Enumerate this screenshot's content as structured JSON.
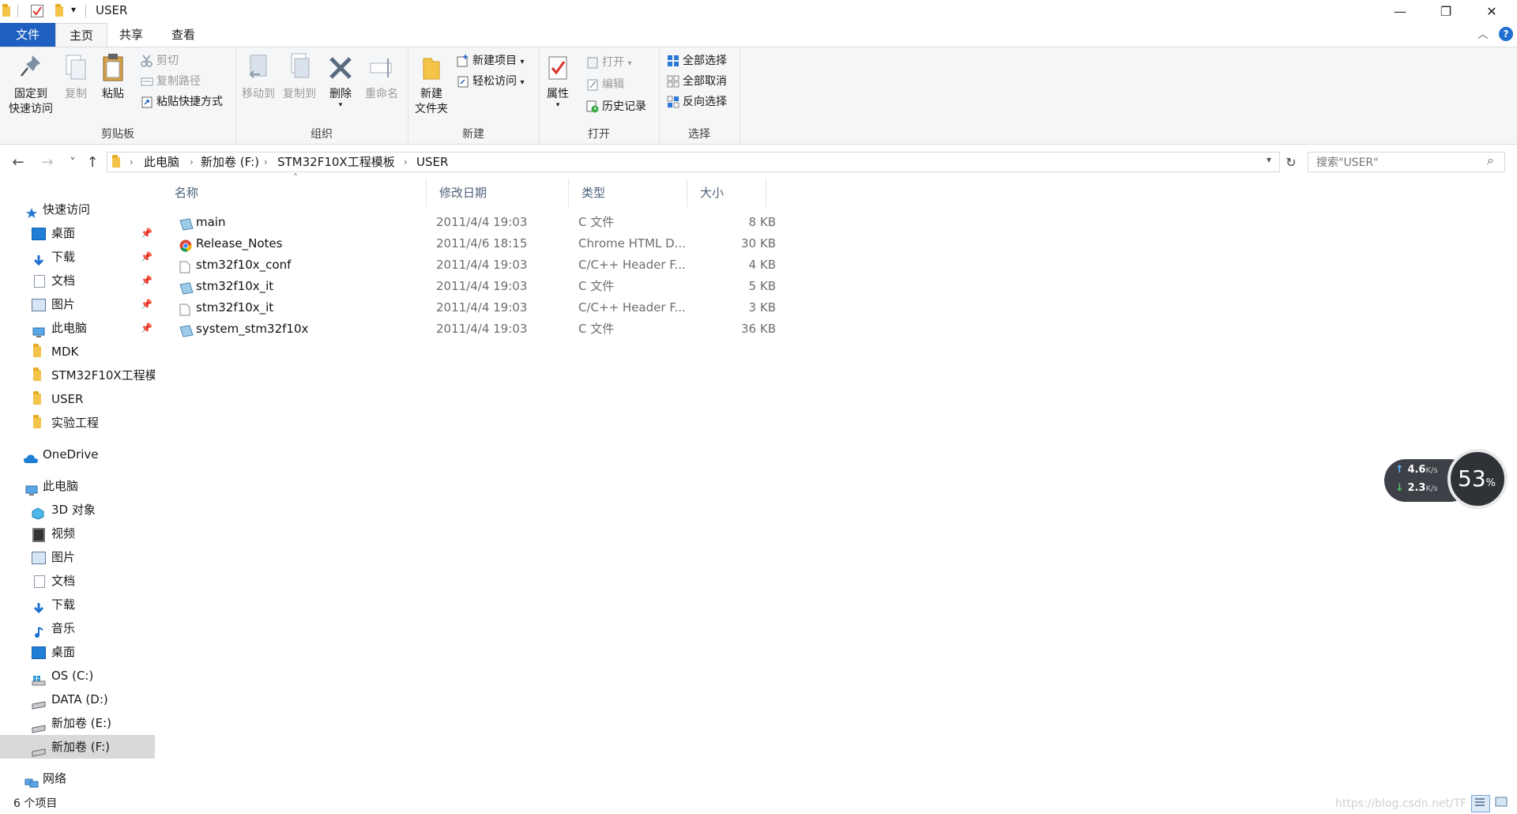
{
  "window": {
    "title": "USER",
    "minimize_glyph": "—",
    "maximize_glyph": "❐",
    "close_glyph": "✕",
    "qa_dropdown_glyph": "▾"
  },
  "ribbon_tabs": {
    "file": "文件",
    "home": "主页",
    "share": "共享",
    "view": "查看",
    "collapse_glyph": "︿",
    "help_glyph": "?"
  },
  "ribbon": {
    "clipboard": {
      "pin_quick_line1": "固定到",
      "pin_quick_line2": "快速访问",
      "copy": "复制",
      "paste": "粘贴",
      "cut": "剪切",
      "copy_path": "复制路径",
      "paste_shortcut": "粘贴快捷方式",
      "label": "剪贴板"
    },
    "organize": {
      "move_to": "移动到",
      "copy_to": "复制到",
      "delete": "删除",
      "rename": "重命名",
      "label": "组织"
    },
    "new": {
      "new_folder_line1": "新建",
      "new_folder_line2": "文件夹",
      "new_item": "新建项目",
      "easy_access": "轻松访问",
      "label": "新建"
    },
    "open": {
      "properties": "属性",
      "open": "打开",
      "edit": "编辑",
      "history": "历史记录",
      "label": "打开"
    },
    "select": {
      "select_all": "全部选择",
      "select_none": "全部取消",
      "invert": "反向选择",
      "label": "选择"
    }
  },
  "nav": {
    "back_glyph": "←",
    "forward_glyph": "→",
    "recent_glyph": "˅",
    "up_glyph": "↑",
    "breadcrumbs": [
      "此电脑",
      "新加卷 (F:)",
      "STM32F10X工程模板",
      "USER"
    ],
    "sep_glyph": "›",
    "refresh_glyph": "↻",
    "search_placeholder": "搜索\"USER\"",
    "search_glyph": "⌕"
  },
  "navpane": {
    "quick_access": "快速访问",
    "quick_items": [
      "桌面",
      "下载",
      "文档",
      "图片",
      "此电脑",
      "MDK",
      "STM32F10X工程模",
      "USER",
      "实验工程"
    ],
    "pin_glyph": "📌",
    "onedrive": "OneDrive",
    "this_pc": "此电脑",
    "pc_items": [
      "3D 对象",
      "视频",
      "图片",
      "文档",
      "下载",
      "音乐",
      "桌面",
      "OS (C:)",
      "DATA (D:)",
      "新加卷 (E:)",
      "新加卷 (F:)"
    ],
    "network": "网络"
  },
  "filelist": {
    "columns": {
      "name": "名称",
      "modified": "修改日期",
      "type": "类型",
      "size": "大小"
    },
    "sort_glyph": "˄",
    "files": [
      {
        "name": "main",
        "modified": "2011/4/4 19:03",
        "type": "C 文件",
        "size": "8 KB"
      },
      {
        "name": "Release_Notes",
        "modified": "2011/4/6 18:15",
        "type": "Chrome HTML D...",
        "size": "30 KB"
      },
      {
        "name": "stm32f10x_conf",
        "modified": "2011/4/4 19:03",
        "type": "C/C++ Header F...",
        "size": "4 KB"
      },
      {
        "name": "stm32f10x_it",
        "modified": "2011/4/4 19:03",
        "type": "C 文件",
        "size": "5 KB"
      },
      {
        "name": "stm32f10x_it",
        "modified": "2011/4/4 19:03",
        "type": "C/C++ Header F...",
        "size": "3 KB"
      },
      {
        "name": "system_stm32f10x",
        "modified": "2011/4/4 19:03",
        "type": "C 文件",
        "size": "36 KB"
      }
    ]
  },
  "status": {
    "count": "6 个项目",
    "watermark": "https://blog.csdn.net/TF"
  },
  "netmonitor": {
    "upload": "4.6",
    "download": "2.3",
    "unit": "K/s",
    "percent": "53",
    "percent_sign": "%",
    "up_glyph": "↑",
    "down_glyph": "↓"
  }
}
